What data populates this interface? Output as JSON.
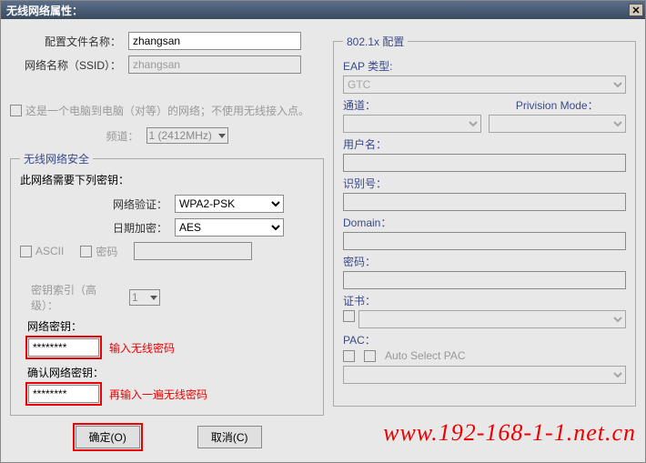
{
  "titlebar": {
    "title": "无线网络属性："
  },
  "left": {
    "config_name_label": "配置文件名称：",
    "config_name_value": "zhangsan",
    "ssid_label": "网络名称（SSID）：",
    "ssid_value": "zhangsan",
    "adhoc_label": "这是一个电脑到电脑（对等）的网络；不使用无线接入点。",
    "channel_label": "频道：",
    "channel_value": "1 (2412MHz)",
    "security": {
      "legend": "无线网络安全",
      "desc": "此网络需要下列密钥：",
      "auth_label": "网络验证：",
      "auth_value": "WPA2-PSK",
      "enc_label": "日期加密：",
      "enc_value": "AES",
      "ascii_label": "ASCII",
      "pwd_cb_label": "密码",
      "key_index_label": "密钥索引（高级）：",
      "key_index_value": "1",
      "net_key_label": "网络密钥：",
      "net_key_value": "********",
      "net_key_hint": "输入无线密码",
      "confirm_key_label": "确认网络密钥：",
      "confirm_key_value": "********",
      "confirm_key_hint": "再输入一遍无线密码"
    },
    "ok_btn": "确定(O)",
    "cancel_btn": "取消(C)"
  },
  "right": {
    "legend": "802.1x 配置",
    "eap_label": "EAP 类型:",
    "eap_value": "GTC",
    "tunnel_label": "通道：",
    "prov_label": "Privision Mode：",
    "user_label": "用户名：",
    "id_label": "识别号：",
    "domain_label": "Domain：",
    "pwd_label": "密码：",
    "cert_label": "证书：",
    "pac_label": "PAC：",
    "auto_pac_label": "Auto Select PAC"
  },
  "watermark": "www.192-168-1-1.net.cn"
}
